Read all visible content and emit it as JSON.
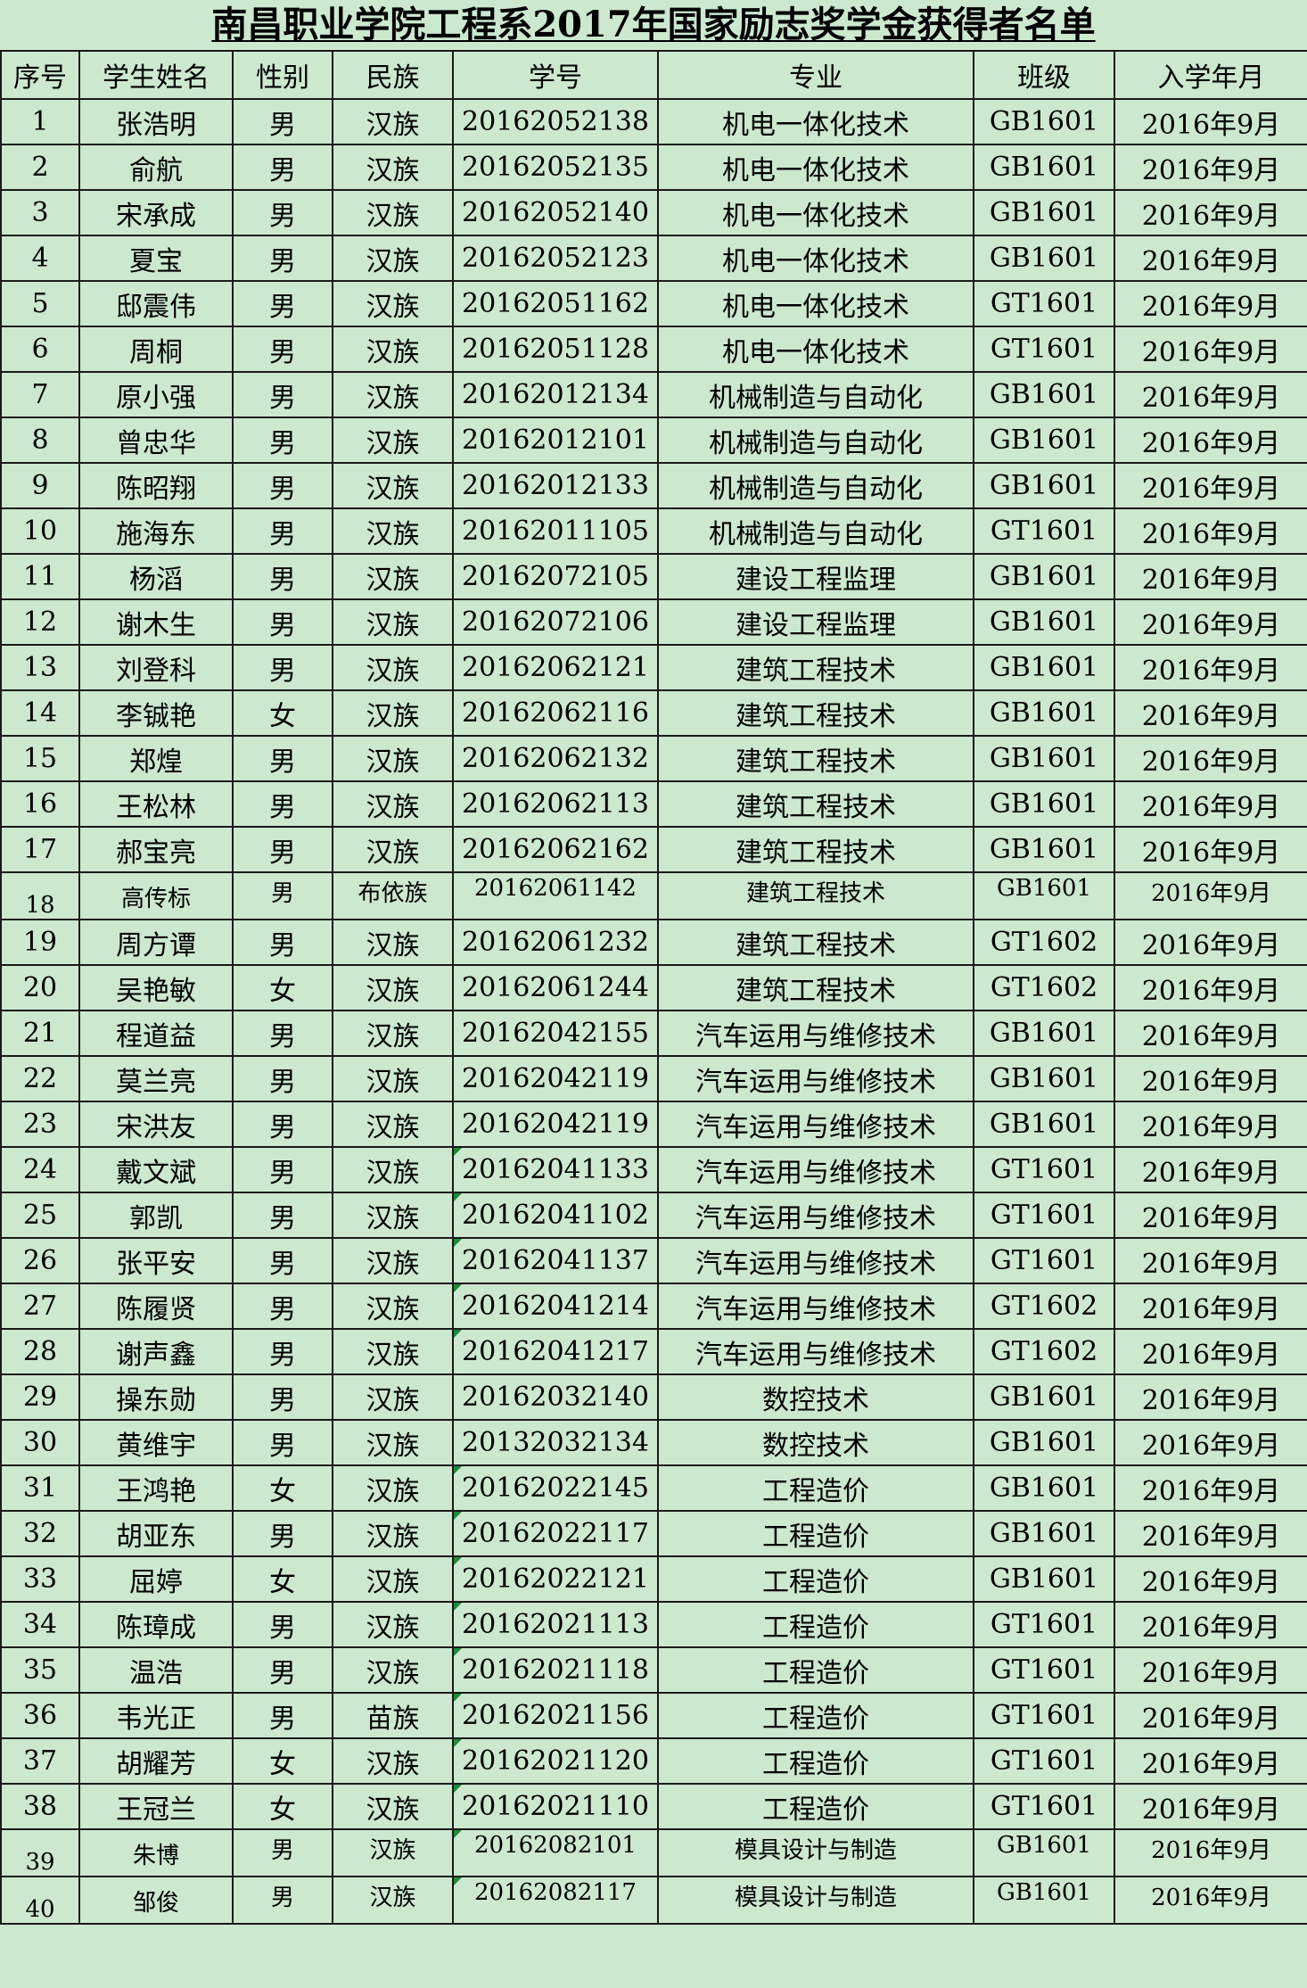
{
  "title": "南昌职业学院工程系2017年国家励志奖学金获得者名单",
  "headers": [
    "序号",
    "学生姓名",
    "性别",
    "民族",
    "学号",
    "专业",
    "班级",
    "入学年月"
  ],
  "rows": [
    [
      "1",
      "张浩明",
      "男",
      "汉族",
      "20162052138",
      "机电一体化技术",
      "GB1601",
      "2016年9月"
    ],
    [
      "2",
      "俞航",
      "男",
      "汉族",
      "20162052135",
      "机电一体化技术",
      "GB1601",
      "2016年9月"
    ],
    [
      "3",
      "宋承成",
      "男",
      "汉族",
      "20162052140",
      "机电一体化技术",
      "GB1601",
      "2016年9月"
    ],
    [
      "4",
      "夏宝",
      "男",
      "汉族",
      "20162052123",
      "机电一体化技术",
      "GB1601",
      "2016年9月"
    ],
    [
      "5",
      "邸震伟",
      "男",
      "汉族",
      "20162051162",
      "机电一体化技术",
      "GT1601",
      "2016年9月"
    ],
    [
      "6",
      "周桐",
      "男",
      "汉族",
      "20162051128",
      "机电一体化技术",
      "GT1601",
      "2016年9月"
    ],
    [
      "7",
      "原小强",
      "男",
      "汉族",
      "20162012134",
      "机械制造与自动化",
      "GB1601",
      "2016年9月"
    ],
    [
      "8",
      "曾忠华",
      "男",
      "汉族",
      "20162012101",
      "机械制造与自动化",
      "GB1601",
      "2016年9月"
    ],
    [
      "9",
      "陈昭翔",
      "男",
      "汉族",
      "20162012133",
      "机械制造与自动化",
      "GB1601",
      "2016年9月"
    ],
    [
      "10",
      "施海东",
      "男",
      "汉族",
      "20162011105",
      "机械制造与自动化",
      "GT1601",
      "2016年9月"
    ],
    [
      "11",
      "杨滔",
      "男",
      "汉族",
      "20162072105",
      "建设工程监理",
      "GB1601",
      "2016年9月"
    ],
    [
      "12",
      "谢木生",
      "男",
      "汉族",
      "20162072106",
      "建设工程监理",
      "GB1601",
      "2016年9月"
    ],
    [
      "13",
      "刘登科",
      "男",
      "汉族",
      "20162062121",
      "建筑工程技术",
      "GB1601",
      "2016年9月"
    ],
    [
      "14",
      "李铖艳",
      "女",
      "汉族",
      "20162062116",
      "建筑工程技术",
      "GB1601",
      "2016年9月"
    ],
    [
      "15",
      "郑煌",
      "男",
      "汉族",
      "20162062132",
      "建筑工程技术",
      "GB1601",
      "2016年9月"
    ],
    [
      "16",
      "王松林",
      "男",
      "汉族",
      "20162062113",
      "建筑工程技术",
      "GB1601",
      "2016年9月"
    ],
    [
      "17",
      "郝宝亮",
      "男",
      "汉族",
      "20162062162",
      "建筑工程技术",
      "GB1601",
      "2016年9月"
    ],
    [
      "18",
      "高传标",
      "男",
      "布依族",
      "20162061142",
      "建筑工程技术",
      "GB1601",
      "2016年9月"
    ],
    [
      "19",
      "周方谭",
      "男",
      "汉族",
      "20162061232",
      "建筑工程技术",
      "GT1602",
      "2016年9月"
    ],
    [
      "20",
      "吴艳敏",
      "女",
      "汉族",
      "20162061244",
      "建筑工程技术",
      "GT1602",
      "2016年9月"
    ],
    [
      "21",
      "程道益",
      "男",
      "汉族",
      "20162042155",
      "汽车运用与维修技术",
      "GB1601",
      "2016年9月"
    ],
    [
      "22",
      "莫兰亮",
      "男",
      "汉族",
      "20162042119",
      "汽车运用与维修技术",
      "GB1601",
      "2016年9月"
    ],
    [
      "23",
      "宋洪友",
      "男",
      "汉族",
      "20162042119",
      "汽车运用与维修技术",
      "GB1601",
      "2016年9月"
    ],
    [
      "24",
      "戴文斌",
      "男",
      "汉族",
      "20162041133",
      "汽车运用与维修技术",
      "GT1601",
      "2016年9月"
    ],
    [
      "25",
      "郭凯",
      "男",
      "汉族",
      "20162041102",
      "汽车运用与维修技术",
      "GT1601",
      "2016年9月"
    ],
    [
      "26",
      "张平安",
      "男",
      "汉族",
      "20162041137",
      "汽车运用与维修技术",
      "GT1601",
      "2016年9月"
    ],
    [
      "27",
      "陈履贤",
      "男",
      "汉族",
      "20162041214",
      "汽车运用与维修技术",
      "GT1602",
      "2016年9月"
    ],
    [
      "28",
      "谢声鑫",
      "男",
      "汉族",
      "20162041217",
      "汽车运用与维修技术",
      "GT1602",
      "2016年9月"
    ],
    [
      "29",
      "操东勋",
      "男",
      "汉族",
      "20162032140",
      "数控技术",
      "GB1601",
      "2016年9月"
    ],
    [
      "30",
      "黄维宇",
      "男",
      "汉族",
      "20132032134",
      "数控技术",
      "GB1601",
      "2016年9月"
    ],
    [
      "31",
      "王鸿艳",
      "女",
      "汉族",
      "20162022145",
      "工程造价",
      "GB1601",
      "2016年9月"
    ],
    [
      "32",
      "胡亚东",
      "男",
      "汉族",
      "20162022117",
      "工程造价",
      "GB1601",
      "2016年9月"
    ],
    [
      "33",
      "屈婷",
      "女",
      "汉族",
      "20162022121",
      "工程造价",
      "GB1601",
      "2016年9月"
    ],
    [
      "34",
      "陈璋成",
      "男",
      "汉族",
      "20162021113",
      "工程造价",
      "GT1601",
      "2016年9月"
    ],
    [
      "35",
      "温浩",
      "男",
      "汉族",
      "20162021118",
      "工程造价",
      "GT1601",
      "2016年9月"
    ],
    [
      "36",
      "韦光正",
      "男",
      "苗族",
      "20162021156",
      "工程造价",
      "GT1601",
      "2016年9月"
    ],
    [
      "37",
      "胡耀芳",
      "女",
      "汉族",
      "20162021120",
      "工程造价",
      "GT1601",
      "2016年9月"
    ],
    [
      "38",
      "王冠兰",
      "女",
      "汉族",
      "20162021110",
      "工程造价",
      "GT1601",
      "2016年9月"
    ],
    [
      "39",
      "朱博",
      "男",
      "汉族",
      "20162082101",
      "模具设计与制造",
      "GB1601",
      "2016年9月"
    ],
    [
      "40",
      "邹俊",
      "男",
      "汉族",
      "20162082117",
      "模具设计与制造",
      "GB1601",
      "2016年9月"
    ]
  ],
  "colors": {
    "background": "#cce8cf",
    "border": "#1a1a1a",
    "cell_flag": "#1e8a3a"
  }
}
